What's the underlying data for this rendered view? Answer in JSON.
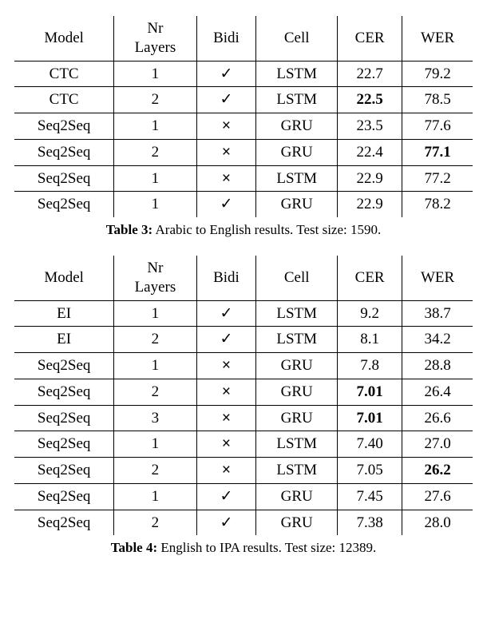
{
  "tables": [
    {
      "headers": [
        "Model",
        "Nr\nLayers",
        "Bidi",
        "Cell",
        "CER",
        "WER"
      ],
      "rows": [
        {
          "cells": [
            "CTC",
            "1",
            "✓",
            "LSTM",
            "22.7",
            "79.2"
          ],
          "bold": []
        },
        {
          "cells": [
            "CTC",
            "2",
            "✓",
            "LSTM",
            "22.5",
            "78.5"
          ],
          "bold": [
            4
          ]
        },
        {
          "cells": [
            "Seq2Seq",
            "1",
            "×",
            "GRU",
            "23.5",
            "77.6"
          ],
          "bold": []
        },
        {
          "cells": [
            "Seq2Seq",
            "2",
            "×",
            "GRU",
            "22.4",
            "77.1"
          ],
          "bold": [
            5
          ]
        },
        {
          "cells": [
            "Seq2Seq",
            "1",
            "×",
            "LSTM",
            "22.9",
            "77.2"
          ],
          "bold": []
        },
        {
          "cells": [
            "Seq2Seq",
            "1",
            "✓",
            "GRU",
            "22.9",
            "78.2"
          ],
          "bold": []
        }
      ],
      "caption_label": "Table 3:",
      "caption_text": " Arabic to English results. Test size: 1590."
    },
    {
      "headers": [
        "Model",
        "Nr\nLayers",
        "Bidi",
        "Cell",
        "CER",
        "WER"
      ],
      "rows": [
        {
          "cells": [
            "EI",
            "1",
            "✓",
            "LSTM",
            "9.2",
            "38.7"
          ],
          "bold": []
        },
        {
          "cells": [
            "EI",
            "2",
            "✓",
            "LSTM",
            "8.1",
            "34.2"
          ],
          "bold": []
        },
        {
          "cells": [
            "Seq2Seq",
            "1",
            "×",
            "GRU",
            "7.8",
            "28.8"
          ],
          "bold": []
        },
        {
          "cells": [
            "Seq2Seq",
            "2",
            "×",
            "GRU",
            "7.01",
            "26.4"
          ],
          "bold": [
            4
          ]
        },
        {
          "cells": [
            "Seq2Seq",
            "3",
            "×",
            "GRU",
            "7.01",
            "26.6"
          ],
          "bold": [
            4
          ]
        },
        {
          "cells": [
            "Seq2Seq",
            "1",
            "×",
            "LSTM",
            "7.40",
            "27.0"
          ],
          "bold": []
        },
        {
          "cells": [
            "Seq2Seq",
            "2",
            "×",
            "LSTM",
            "7.05",
            "26.2"
          ],
          "bold": [
            5
          ]
        },
        {
          "cells": [
            "Seq2Seq",
            "1",
            "✓",
            "GRU",
            "7.45",
            "27.6"
          ],
          "bold": []
        },
        {
          "cells": [
            "Seq2Seq",
            "2",
            "✓",
            "GRU",
            "7.38",
            "28.0"
          ],
          "bold": []
        }
      ],
      "caption_label": "Table 4:",
      "caption_text": " English to IPA results. Test size: 12389."
    }
  ],
  "chart_data": [
    {
      "type": "table",
      "title": "Arabic to English results. Test size: 1590.",
      "columns": [
        "Model",
        "Nr Layers",
        "Bidi",
        "Cell",
        "CER",
        "WER"
      ],
      "rows": [
        [
          "CTC",
          1,
          true,
          "LSTM",
          22.7,
          79.2
        ],
        [
          "CTC",
          2,
          true,
          "LSTM",
          22.5,
          78.5
        ],
        [
          "Seq2Seq",
          1,
          false,
          "GRU",
          23.5,
          77.6
        ],
        [
          "Seq2Seq",
          2,
          false,
          "GRU",
          22.4,
          77.1
        ],
        [
          "Seq2Seq",
          1,
          false,
          "LSTM",
          22.9,
          77.2
        ],
        [
          "Seq2Seq",
          1,
          true,
          "GRU",
          22.9,
          78.2
        ]
      ]
    },
    {
      "type": "table",
      "title": "English to IPA results. Test size: 12389.",
      "columns": [
        "Model",
        "Nr Layers",
        "Bidi",
        "Cell",
        "CER",
        "WER"
      ],
      "rows": [
        [
          "EI",
          1,
          true,
          "LSTM",
          9.2,
          38.7
        ],
        [
          "EI",
          2,
          true,
          "LSTM",
          8.1,
          34.2
        ],
        [
          "Seq2Seq",
          1,
          false,
          "GRU",
          7.8,
          28.8
        ],
        [
          "Seq2Seq",
          2,
          false,
          "GRU",
          7.01,
          26.4
        ],
        [
          "Seq2Seq",
          3,
          false,
          "GRU",
          7.01,
          26.6
        ],
        [
          "Seq2Seq",
          1,
          false,
          "LSTM",
          7.4,
          27.0
        ],
        [
          "Seq2Seq",
          2,
          false,
          "LSTM",
          7.05,
          26.2
        ],
        [
          "Seq2Seq",
          1,
          true,
          "GRU",
          7.45,
          27.6
        ],
        [
          "Seq2Seq",
          2,
          true,
          "GRU",
          7.38,
          28.0
        ]
      ]
    }
  ]
}
